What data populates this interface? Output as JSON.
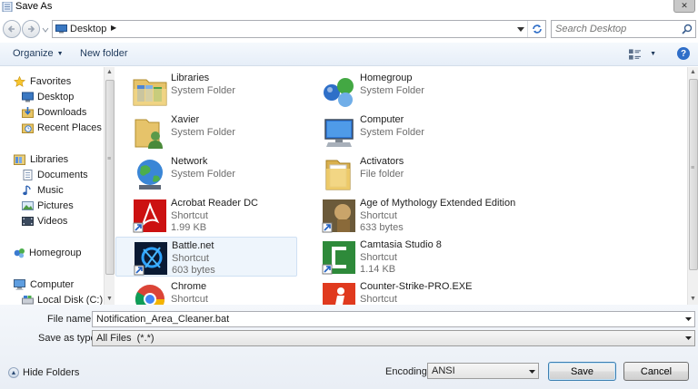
{
  "window": {
    "title": "Save As",
    "close_glyph": "✕"
  },
  "address": {
    "location": "Desktop",
    "crumb_arrow": "▶"
  },
  "search": {
    "placeholder": "Search Desktop"
  },
  "toolbar": {
    "organize_label": "Organize",
    "new_folder_label": "New folder",
    "help_glyph": "?"
  },
  "nav": {
    "items": [
      {
        "label": "Favorites",
        "icon": "star-icon"
      },
      {
        "label": "Desktop",
        "icon": "desktop-icon"
      },
      {
        "label": "Downloads",
        "icon": "downloads-icon"
      },
      {
        "label": "Recent Places",
        "icon": "recent-places-icon"
      },
      {
        "label": "Libraries",
        "icon": "libraries-icon"
      },
      {
        "label": "Documents",
        "icon": "documents-icon"
      },
      {
        "label": "Music",
        "icon": "music-icon"
      },
      {
        "label": "Pictures",
        "icon": "pictures-icon"
      },
      {
        "label": "Videos",
        "icon": "videos-icon"
      },
      {
        "label": "Homegroup",
        "icon": "homegroup-icon"
      },
      {
        "label": "Computer",
        "icon": "computer-icon"
      },
      {
        "label": "Local Disk (C:)",
        "icon": "disk-icon"
      }
    ]
  },
  "files": [
    {
      "name": "Libraries",
      "type": "System Folder",
      "size": "",
      "icon": "libraries-folder-icon"
    },
    {
      "name": "Homegroup",
      "type": "System Folder",
      "size": "",
      "icon": "homegroup-icon"
    },
    {
      "name": "Xavier",
      "type": "System Folder",
      "size": "",
      "icon": "user-folder-icon"
    },
    {
      "name": "Computer",
      "type": "System Folder",
      "size": "",
      "icon": "computer-icon"
    },
    {
      "name": "Network",
      "type": "System Folder",
      "size": "",
      "icon": "network-globe-icon"
    },
    {
      "name": "Activators",
      "type": "File folder",
      "size": "",
      "icon": "folder-icon"
    },
    {
      "name": "Acrobat Reader DC",
      "type": "Shortcut",
      "size": "1.99 KB",
      "icon": "acrobat-icon"
    },
    {
      "name": "Age of Mythology Extended Edition",
      "type": "Shortcut",
      "size": "633 bytes",
      "icon": "age-of-mythology-icon"
    },
    {
      "name": "Battle.net",
      "type": "Shortcut",
      "size": "603 bytes",
      "icon": "battlenet-icon",
      "selected": true
    },
    {
      "name": "Camtasia Studio 8",
      "type": "Shortcut",
      "size": "1.14 KB",
      "icon": "camtasia-icon"
    },
    {
      "name": "Chrome",
      "type": "Shortcut",
      "size": "",
      "icon": "chrome-icon"
    },
    {
      "name": "Counter-Strike-PRO.EXE",
      "type": "Shortcut",
      "size": "",
      "icon": "counter-strike-icon"
    }
  ],
  "form": {
    "file_name_label": "File name:",
    "file_name_value": "Notification_Area_Cleaner.bat",
    "save_type_label": "Save as type:",
    "save_type_value": "All Files  (*.*)",
    "hide_folders_label": "Hide Folders",
    "encoding_label": "Encoding:",
    "encoding_value": "ANSI",
    "save_label": "Save",
    "cancel_label": "Cancel"
  }
}
